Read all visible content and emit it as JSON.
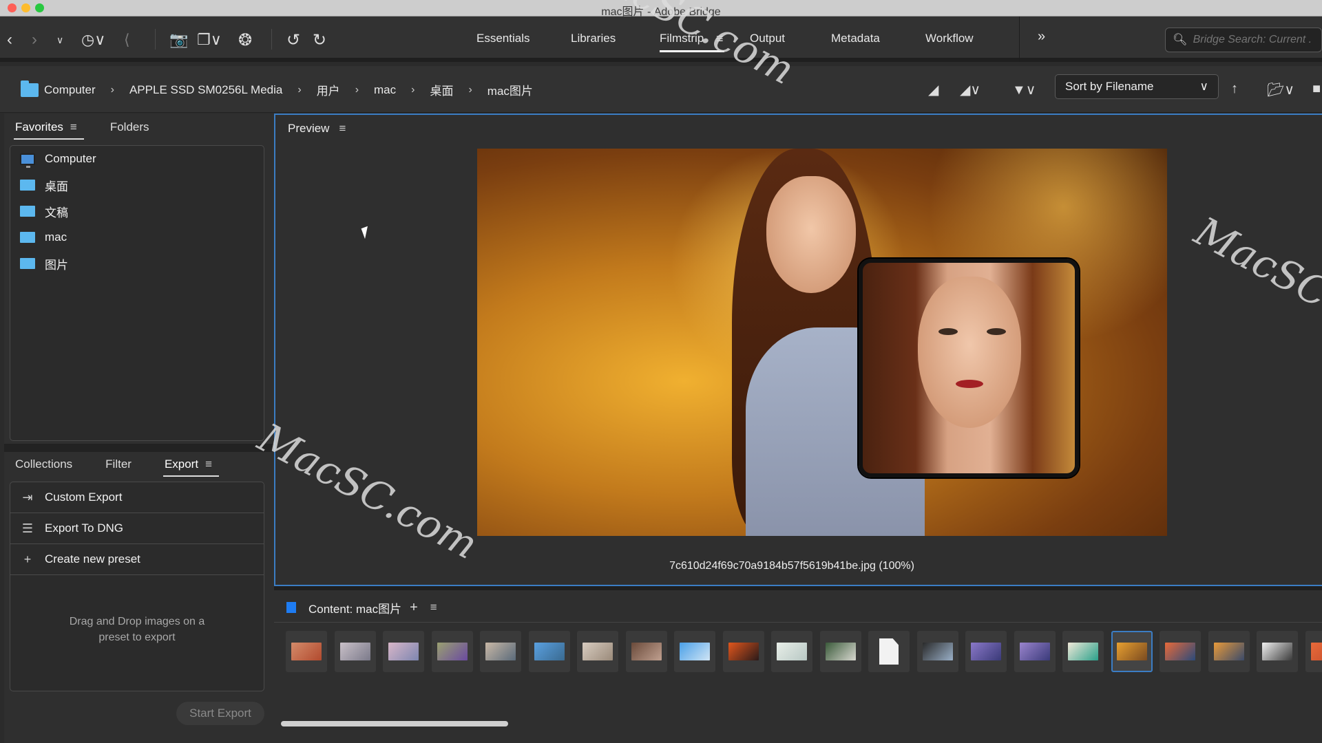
{
  "window": {
    "title": "mac图片 - Adobe Bridge"
  },
  "toolbar": {
    "icons": [
      "back-icon",
      "forward-icon",
      "recent-dropdown-icon",
      "history-icon",
      "boomerang-icon",
      "get-photos-icon",
      "copy-files-icon",
      "camera-raw-icon",
      "rotate-left-icon",
      "rotate-right-icon"
    ],
    "workspaces": [
      {
        "label": "Essentials"
      },
      {
        "label": "Libraries"
      },
      {
        "label": "Filmstrip",
        "active": true
      },
      {
        "label": "Output"
      },
      {
        "label": "Metadata"
      },
      {
        "label": "Workflow"
      }
    ],
    "more_label": "»",
    "search_placeholder": "Bridge Search: Current ."
  },
  "path": {
    "crumbs": [
      "Computer",
      "APPLE SSD SM0256L Media",
      "用户",
      "mac",
      "桌面",
      "mac图片"
    ],
    "sort_label": "Sort by Filename"
  },
  "favorites_panel": {
    "tabs": [
      {
        "label": "Favorites",
        "active": true
      },
      {
        "label": "Folders"
      }
    ],
    "items": [
      {
        "label": "Computer",
        "icon": "computer-icon"
      },
      {
        "label": "桌面",
        "icon": "folder-icon"
      },
      {
        "label": "文稿",
        "icon": "folder-icon"
      },
      {
        "label": "mac",
        "icon": "folder-icon"
      },
      {
        "label": "图片",
        "icon": "folder-icon"
      }
    ]
  },
  "export_panel": {
    "tabs": [
      {
        "label": "Collections"
      },
      {
        "label": "Filter"
      },
      {
        "label": "Export",
        "active": true
      }
    ],
    "items": [
      {
        "label": "Custom Export",
        "icon": "custom-export-icon"
      },
      {
        "label": "Export To DNG",
        "icon": "list-icon"
      },
      {
        "label": "Create new preset",
        "icon": "plus-icon"
      }
    ],
    "drop_note_1": "Drag and Drop images on a",
    "drop_note_2": "preset to export",
    "start_label": "Start Export"
  },
  "preview": {
    "title": "Preview",
    "caption": "7c610d24f69c70a9184b57f5619b41be.jpg (100%)"
  },
  "content": {
    "title": "Content: mac图片",
    "thumbnails": [
      {
        "colors": [
          "#d48b6a",
          "#b24a2e"
        ]
      },
      {
        "colors": [
          "#c9c0c8",
          "#7b7a8a"
        ]
      },
      {
        "colors": [
          "#d8b6c8",
          "#7d86b0"
        ]
      },
      {
        "colors": [
          "#9aa070",
          "#6a4aa0"
        ]
      },
      {
        "colors": [
          "#c9b8a6",
          "#5a6a7a"
        ]
      },
      {
        "colors": [
          "#5aa0e0",
          "#3a6a90"
        ]
      },
      {
        "colors": [
          "#d8ccc0",
          "#9a8a7a"
        ]
      },
      {
        "colors": [
          "#6a4a3a",
          "#c0a090"
        ]
      },
      {
        "colors": [
          "#4aa0e8",
          "#d0e4f4"
        ]
      },
      {
        "colors": [
          "#e2561c",
          "#2a1a1a"
        ]
      },
      {
        "colors": [
          "#e8eee8",
          "#b8c8c4"
        ]
      },
      {
        "colors": [
          "#3a5a3a",
          "#d8d8d0"
        ]
      },
      {
        "doc": true
      },
      {
        "colors": [
          "#2a2a2a",
          "#9ab0c8"
        ]
      },
      {
        "colors": [
          "#8a78c8",
          "#3a3a78"
        ]
      },
      {
        "colors": [
          "#9a84cc",
          "#3a3a7a"
        ]
      },
      {
        "colors": [
          "#f0e8d8",
          "#2aa08a"
        ]
      },
      {
        "colors": [
          "#e8a030",
          "#7a4a20"
        ],
        "selected": true
      },
      {
        "colors": [
          "#e86a3a",
          "#2a4a7a"
        ]
      },
      {
        "colors": [
          "#e89a3a",
          "#3a4a6a"
        ]
      },
      {
        "colors": [
          "#f0f0f0",
          "#3a3a3a"
        ]
      },
      {
        "colors": [
          "#e86a3a",
          "#c04a2a"
        ]
      }
    ]
  },
  "watermark": "MacSC.com"
}
